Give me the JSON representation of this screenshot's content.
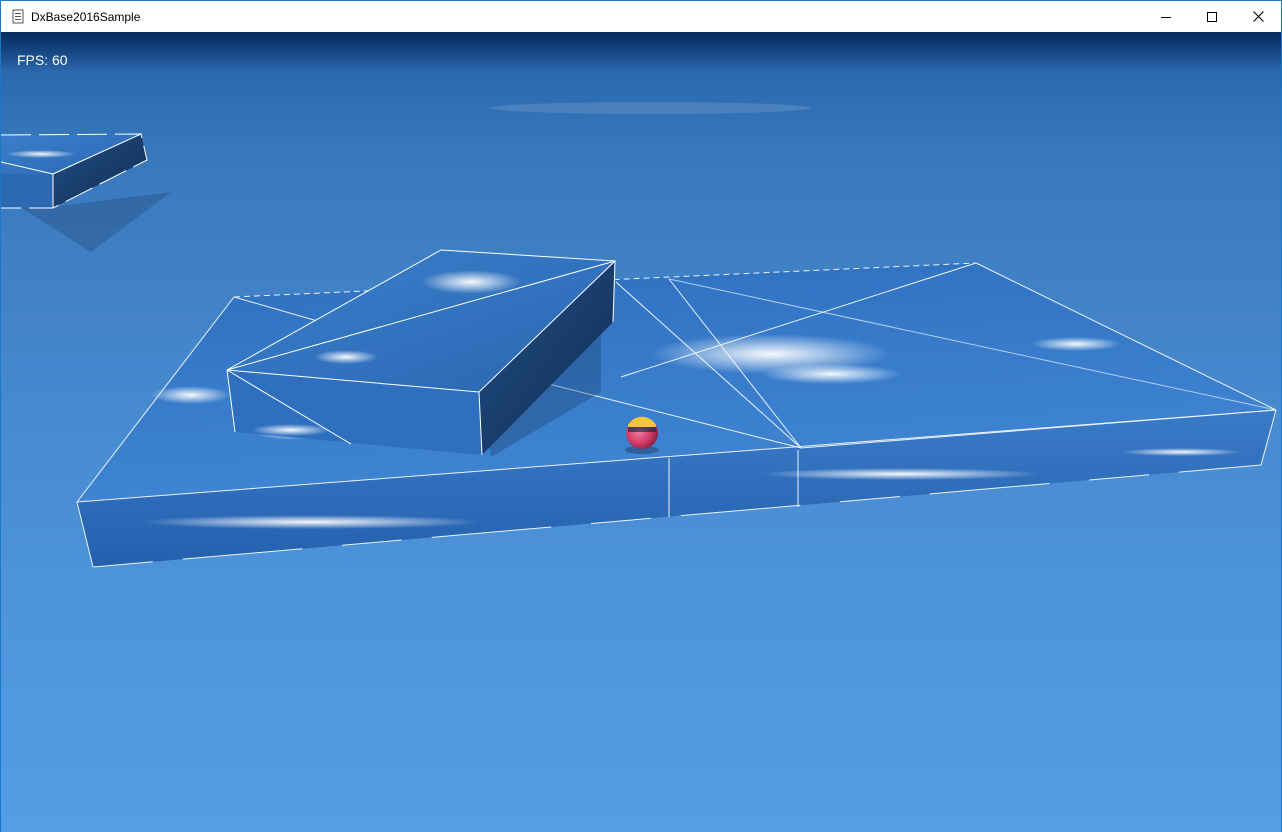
{
  "window": {
    "title": "DxBase2016Sample",
    "icons": {
      "app": "app-icon",
      "minimize": "minimize-icon",
      "maximize": "maximize-icon",
      "close": "close-icon"
    }
  },
  "hud": {
    "fps_label": "FPS: 60"
  },
  "scene": {
    "sky_colors": {
      "top": "#0a2c5e",
      "horizon": "#3878bd",
      "bottom": "#549ee6"
    },
    "platform_side_color": "#1e4f8c",
    "wireframe_color": "#ffffff",
    "ball_colors": {
      "body": "#d63d6a",
      "highlight": "#f3c63a"
    }
  }
}
